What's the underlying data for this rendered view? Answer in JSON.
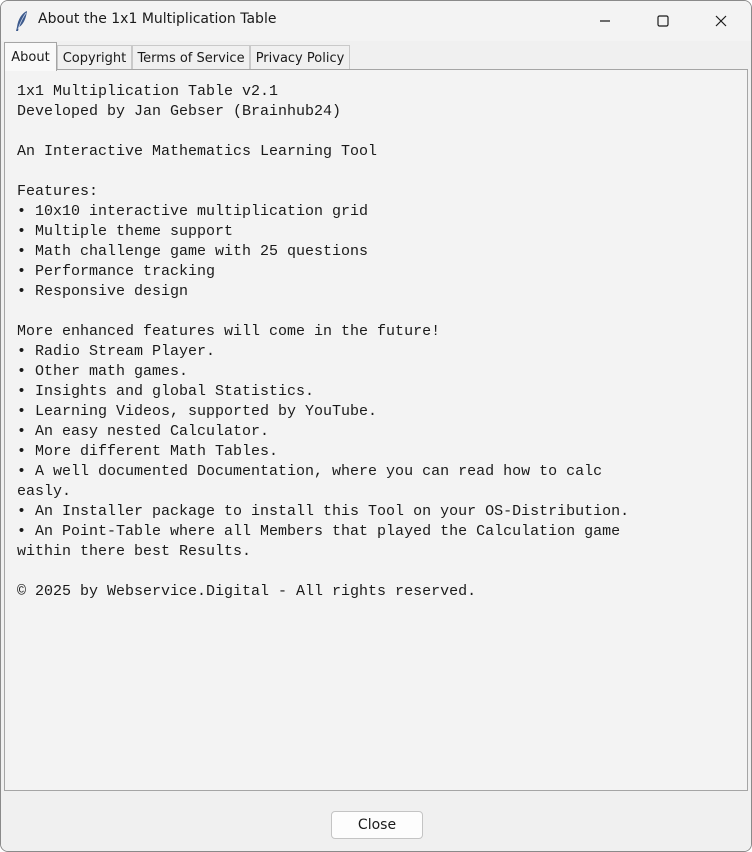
{
  "window": {
    "title": "About the 1x1 Multiplication Table",
    "app_icon": "feather-icon",
    "controls": [
      "minimize-icon",
      "maximize-icon",
      "close-icon"
    ]
  },
  "tabs": [
    {
      "label": "About",
      "selected": true
    },
    {
      "label": "Copyright",
      "selected": false
    },
    {
      "label": "Terms of Service",
      "selected": false
    },
    {
      "label": "Privacy Policy",
      "selected": false
    }
  ],
  "about": {
    "lines": [
      "1x1 Multiplication Table v2.1",
      "Developed by Jan Gebser (Brainhub24)",
      "",
      "An Interactive Mathematics Learning Tool",
      "",
      "Features:",
      "• 10x10 interactive multiplication grid",
      "• Multiple theme support",
      "• Math challenge game with 25 questions",
      "• Performance tracking",
      "• Responsive design",
      "",
      "More enhanced features will come in the future!",
      "• Radio Stream Player.",
      "• Other math games.",
      "• Insights and global Statistics.",
      "• Learning Videos, supported by YouTube.",
      "• An easy nested Calculator.",
      "• More different Math Tables.",
      "• A well documented Documentation, where you can read how to calc",
      "easly.",
      "• An Installer package to install this Tool on your OS-Distribution.",
      "• An Point-Table where all Members that played the Calculation game",
      "within there best Results.",
      "",
      "© 2025 by Webservice.Digital - All rights reserved."
    ]
  },
  "footer": {
    "close_label": "Close"
  }
}
